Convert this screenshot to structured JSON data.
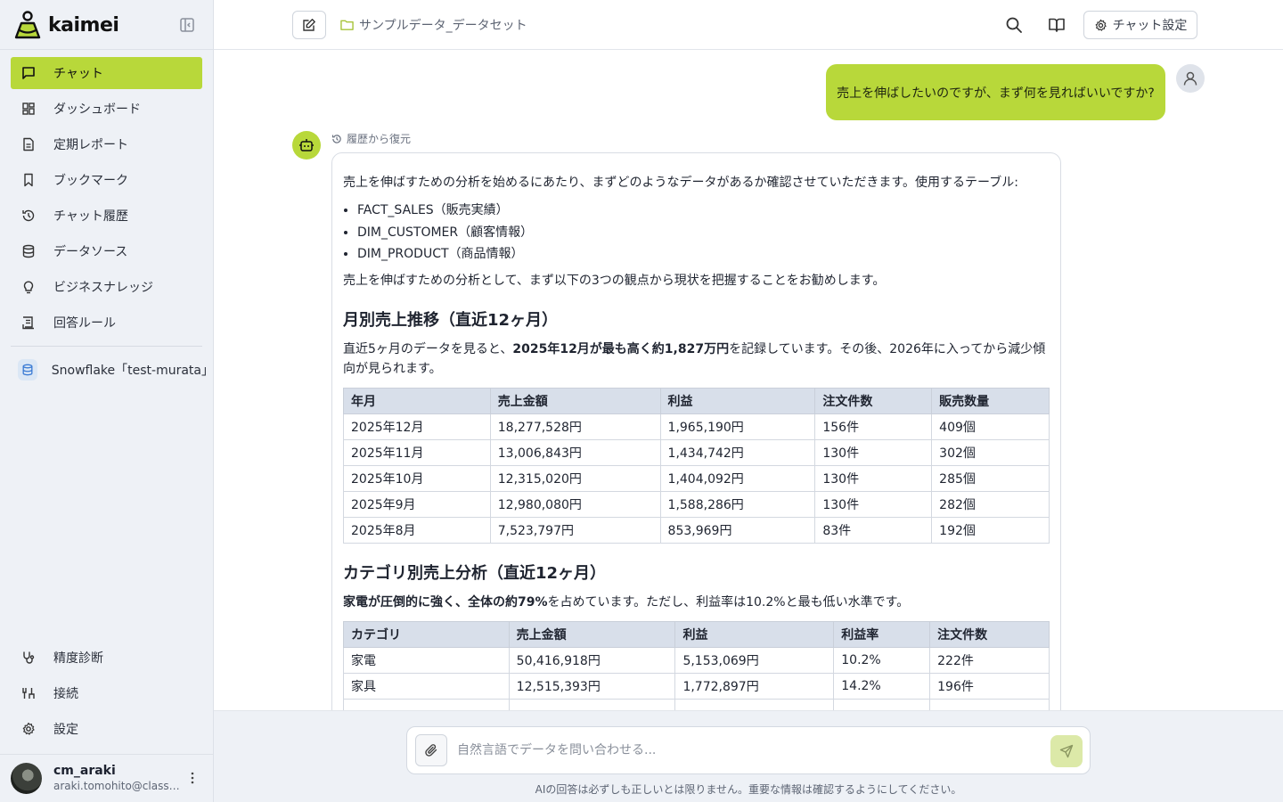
{
  "brand": {
    "name": "kaimei"
  },
  "sidebar": {
    "items": [
      {
        "label": "チャット",
        "icon": "chat-bubble-icon"
      },
      {
        "label": "ダッシュボード",
        "icon": "dashboard-icon"
      },
      {
        "label": "定期レポート",
        "icon": "report-icon"
      },
      {
        "label": "ブックマーク",
        "icon": "bookmark-icon"
      },
      {
        "label": "チャット履歴",
        "icon": "history-icon"
      },
      {
        "label": "データソース",
        "icon": "database-icon"
      },
      {
        "label": "ビジネスナレッジ",
        "icon": "lightbulb-icon"
      },
      {
        "label": "回答ルール",
        "icon": "rules-icon"
      }
    ],
    "datasource": "Snowflake「test-murata」",
    "bottom_items": [
      {
        "label": "精度診断",
        "icon": "stethoscope-icon"
      },
      {
        "label": "接続",
        "icon": "connection-icon"
      },
      {
        "label": "設定",
        "icon": "gear-icon"
      }
    ],
    "user": {
      "name": "cm_araki",
      "email": "araki.tomohito@classmethod.jp"
    }
  },
  "header": {
    "dataset": "サンプルデータ_データセット",
    "chat_settings": "チャット設定"
  },
  "chat": {
    "user_message": "売上を伸ばしたいのですが、まず何を見ればいいですか?",
    "restored_label": "履歴から復元",
    "intro": "売上を伸ばすための分析を始めるにあたり、まずどのようなデータがあるか確認させていただきます。使用するテーブル:",
    "tables_used": [
      "FACT_SALES（販売実績）",
      "DIM_CUSTOMER（顧客情報）",
      "DIM_PRODUCT（商品情報）"
    ],
    "lead": "売上を伸ばすための分析として、まず以下の3つの観点から現状を把握することをお勧めします。",
    "section1": {
      "title": "月別売上推移（直近12ヶ月）",
      "text_before": "直近5ヶ月のデータを見ると、",
      "text_bold": "2025年12月が最も高く約1,827万円",
      "text_after": "を記録しています。その後、2026年に入ってから減少傾向が見られます。",
      "headers": [
        "年月",
        "売上金額",
        "利益",
        "注文件数",
        "販売数量"
      ],
      "rows": [
        [
          "2025年12月",
          "18,277,528円",
          "1,965,190円",
          "156件",
          "409個"
        ],
        [
          "2025年11月",
          "13,006,843円",
          "1,434,742円",
          "130件",
          "302個"
        ],
        [
          "2025年10月",
          "12,315,020円",
          "1,404,092円",
          "130件",
          "285個"
        ],
        [
          "2025年9月",
          "12,980,080円",
          "1,588,286円",
          "130件",
          "282個"
        ],
        [
          "2025年8月",
          "7,523,797円",
          "853,969円",
          "83件",
          "192個"
        ]
      ]
    },
    "section2": {
      "title": "カテゴリ別売上分析（直近12ヶ月）",
      "text_bold": "家電が圧倒的に強く、全体の約79%",
      "text_after": "を占めています。ただし、利益率は10.2%と最も低い水準です。",
      "headers": [
        "カテゴリ",
        "売上金額",
        "利益",
        "利益率",
        "注文件数"
      ],
      "rows": [
        [
          "家電",
          "50,416,918円",
          "5,153,069円",
          "10.2%",
          "222件"
        ],
        [
          "家具",
          "12,515,393円",
          "1,772,897円",
          "14.2%",
          "196件"
        ]
      ]
    }
  },
  "composer": {
    "placeholder": "自然言語でデータを問い合わせる...",
    "disclaimer": "AIの回答は必ずしも正しいとは限りません。重要な情報は確認するようにしてください。"
  },
  "colors": {
    "accent": "#b8d83a",
    "sidebar_bg": "#eef1f6",
    "table_header": "#d8dfea"
  }
}
